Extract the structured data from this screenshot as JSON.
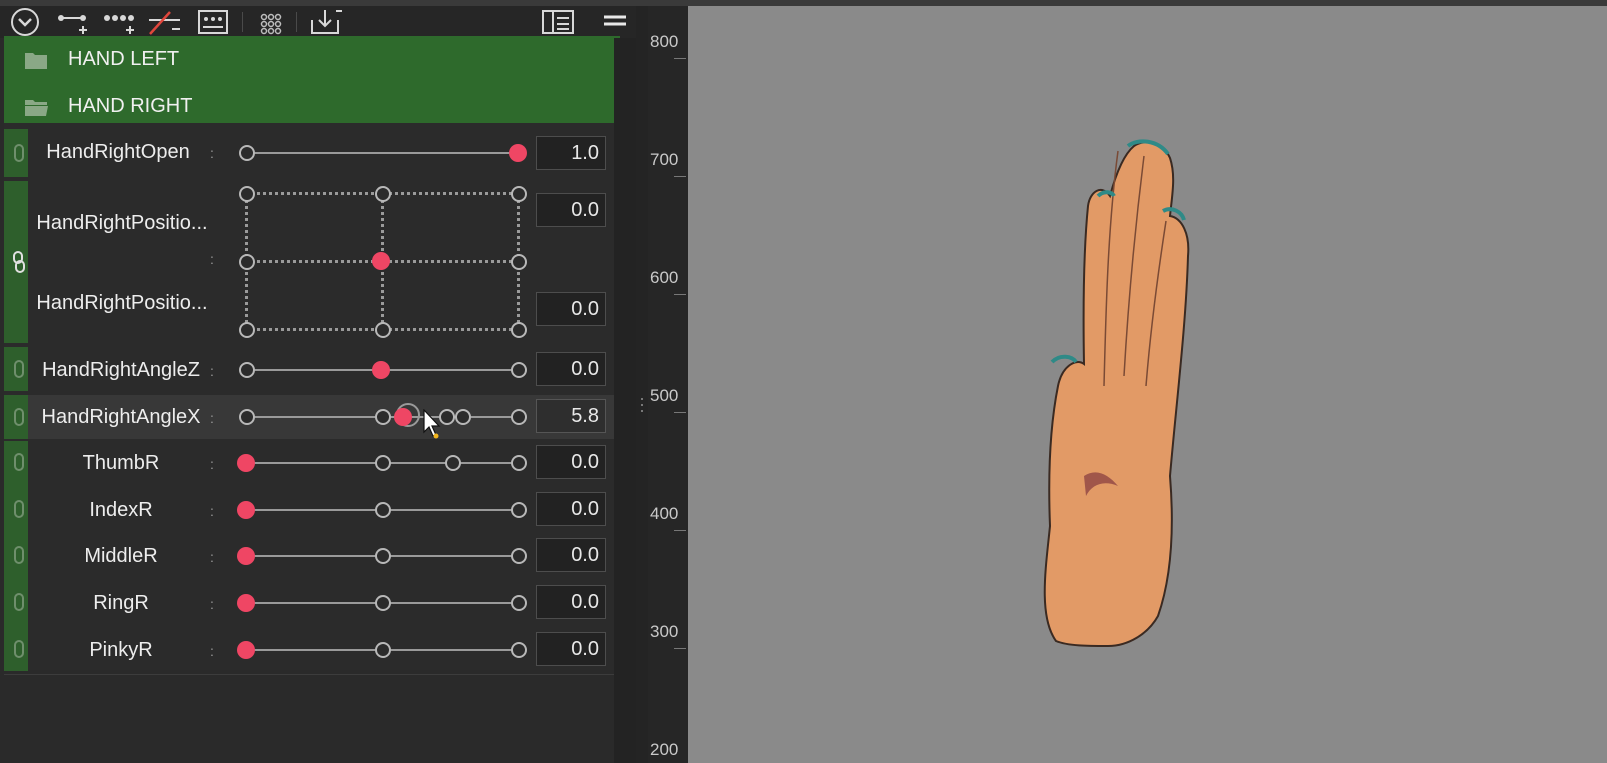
{
  "toolbar": {
    "icons": [
      "collapse-icon",
      "add-param-icon",
      "add-group-icon",
      "delete-icon",
      "param-list-icon",
      "grid-icon",
      "export-icon",
      "view-toggle-icon",
      "menu-icon"
    ]
  },
  "groups": [
    {
      "label": "HAND LEFT",
      "open": false
    },
    {
      "label": "HAND RIGHT",
      "open": true
    }
  ],
  "params": {
    "open": {
      "name": "HandRightOpen",
      "value": "1.0"
    },
    "pos1": {
      "name": "HandRightPositio...",
      "value": "0.0"
    },
    "pos2": {
      "name": "HandRightPositio...",
      "value": "0.0"
    },
    "angleZ": {
      "name": "HandRightAngleZ",
      "value": "0.0"
    },
    "angleX": {
      "name": "HandRightAngleX",
      "value": "5.8"
    },
    "thumb": {
      "name": "ThumbR",
      "value": "0.0"
    },
    "index": {
      "name": "IndexR",
      "value": "0.0"
    },
    "middle": {
      "name": "MiddleR",
      "value": "0.0"
    },
    "ring": {
      "name": "RingR",
      "value": "0.0"
    },
    "pinky": {
      "name": "PinkyR",
      "value": "0.0"
    }
  },
  "colon": ":",
  "ruler": {
    "labels": [
      "800",
      "700",
      "600",
      "500",
      "400",
      "300",
      "200"
    ]
  },
  "colors": {
    "accent": "#ef4664",
    "group_bg": "#2e6a2c",
    "viewport": "#8a8a8a",
    "hand": "#e29a66"
  }
}
